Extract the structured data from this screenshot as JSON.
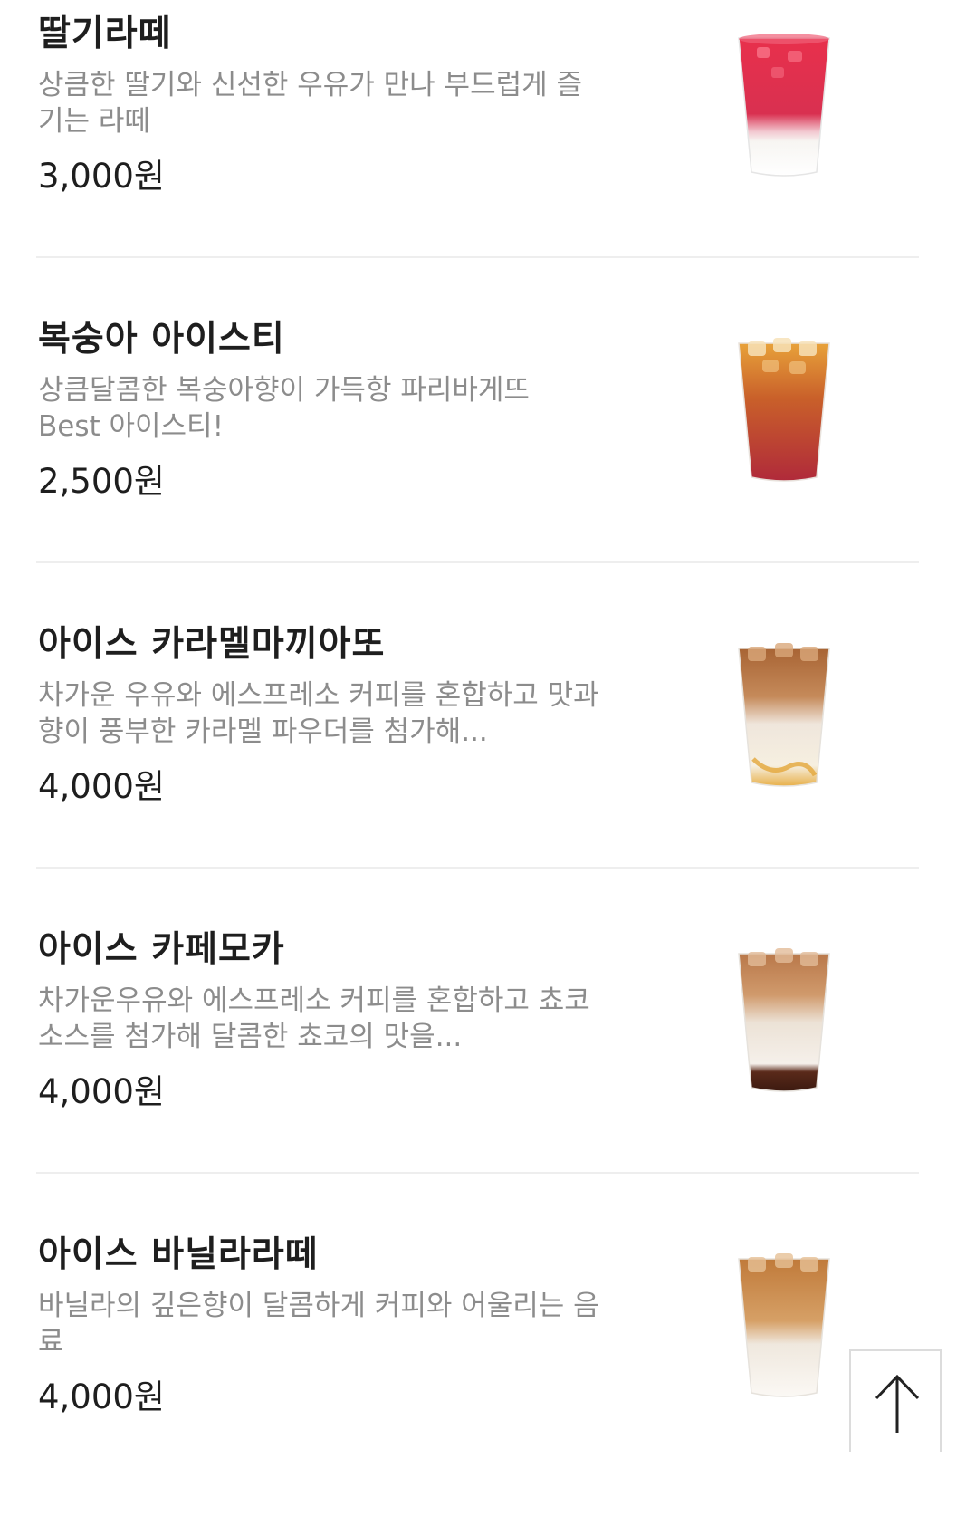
{
  "menu": {
    "items": [
      {
        "name": "딸기라떼",
        "description": "상큼한 딸기와 신선한 우유가 만나 부드럽게 즐기는 라떼",
        "price": "3,000원",
        "image": "strawberry-latte-cup"
      },
      {
        "name": "복숭아 아이스티",
        "description": "상큼달콤한 복숭아향이 가득항 파리바게뜨 Best 아이스티!",
        "price": "2,500원",
        "image": "peach-iced-tea-cup"
      },
      {
        "name": "아이스 카라멜마끼아또",
        "description": "차가운 우유와 에스프레소 커피를 혼합하고 맛과 향이 풍부한 카라멜 파우더를 첨가해...",
        "price": "4,000원",
        "image": "iced-caramel-macchiato-cup"
      },
      {
        "name": "아이스 카페모카",
        "description": "차가운우유와 에스프레소 커피를 혼합하고 쵸코소스를 첨가해 달콤한 쵸코의 맛을...",
        "price": "4,000원",
        "image": "iced-cafe-mocha-cup"
      },
      {
        "name": "아이스 바닐라라떼",
        "description": "바닐라의 깊은향이 달콤하게 커피와 어울리는 음료",
        "price": "4,000원",
        "image": "iced-vanilla-latte-cup"
      }
    ]
  },
  "scroll_top": {
    "icon": "arrow-up-icon"
  },
  "colors": {
    "title": "#1e1e1e",
    "description": "#8c8c8c",
    "divider": "#eeeeee"
  }
}
